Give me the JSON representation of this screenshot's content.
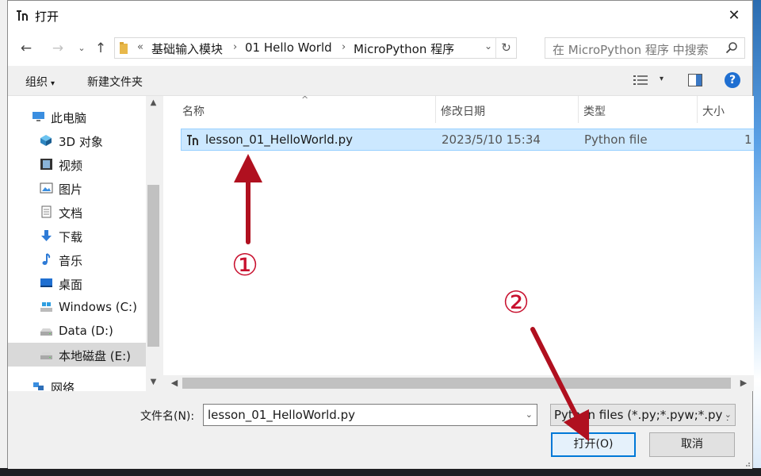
{
  "window": {
    "title": "打开",
    "close_symbol": "✕"
  },
  "nav": {
    "back": "←",
    "forward": "→",
    "history": "⌄",
    "up": "↑"
  },
  "address": {
    "overflow": "«",
    "segments": [
      "基础输入模块",
      "01 Hello World",
      "MicroPython 程序"
    ],
    "separator": "›",
    "dropdown": "⌄",
    "refresh": "↻"
  },
  "search": {
    "placeholder": "在 MicroPython 程序 中搜索"
  },
  "toolbar": {
    "organize_label": "组织",
    "organize_arrow": "▾",
    "new_folder_label": "新建文件夹",
    "view_dd": "▾",
    "help_label": "?"
  },
  "sidebar": {
    "items": [
      {
        "label": "此电脑",
        "icon": "computer-icon"
      },
      {
        "label": "3D 对象",
        "icon": "cube-icon"
      },
      {
        "label": "视频",
        "icon": "film-icon"
      },
      {
        "label": "图片",
        "icon": "picture-icon"
      },
      {
        "label": "文档",
        "icon": "document-icon"
      },
      {
        "label": "下载",
        "icon": "download-icon"
      },
      {
        "label": "音乐",
        "icon": "music-icon"
      },
      {
        "label": "桌面",
        "icon": "desktop-icon"
      },
      {
        "label": "Windows (C:)",
        "icon": "windows-drive-icon"
      },
      {
        "label": "Data (D:)",
        "icon": "drive-icon"
      },
      {
        "label": "本地磁盘 (E:)",
        "icon": "drive-icon",
        "selected": true
      },
      {
        "label": "网络",
        "icon": "network-icon"
      }
    ],
    "scroll_up": "▲",
    "scroll_down": "▼"
  },
  "files": {
    "columns": [
      "名称",
      "修改日期",
      "类型",
      "大小"
    ],
    "sort_caret": "^",
    "rows": [
      {
        "name": "lesson_01_HelloWorld.py",
        "date": "2023/5/10 15:34",
        "type": "Python file",
        "size": "1"
      }
    ],
    "scroll_left": "◀",
    "scroll_right": "▶"
  },
  "bottom": {
    "filename_label": "文件名(N):",
    "filename_value": "lesson_01_HelloWorld.py",
    "filename_dd": "⌄",
    "filetype_value": "Python files (*.py;*.pyw;*.pyi)",
    "filetype_dd": "⌄",
    "open_label": "打开(O)",
    "cancel_label": "取消"
  },
  "annotations": {
    "marker_1": "①",
    "marker_2": "②",
    "color": "#b0101f"
  },
  "colors": {
    "selection": "#cce8ff",
    "accent": "#0078d7",
    "help": "#1f6fd1"
  }
}
